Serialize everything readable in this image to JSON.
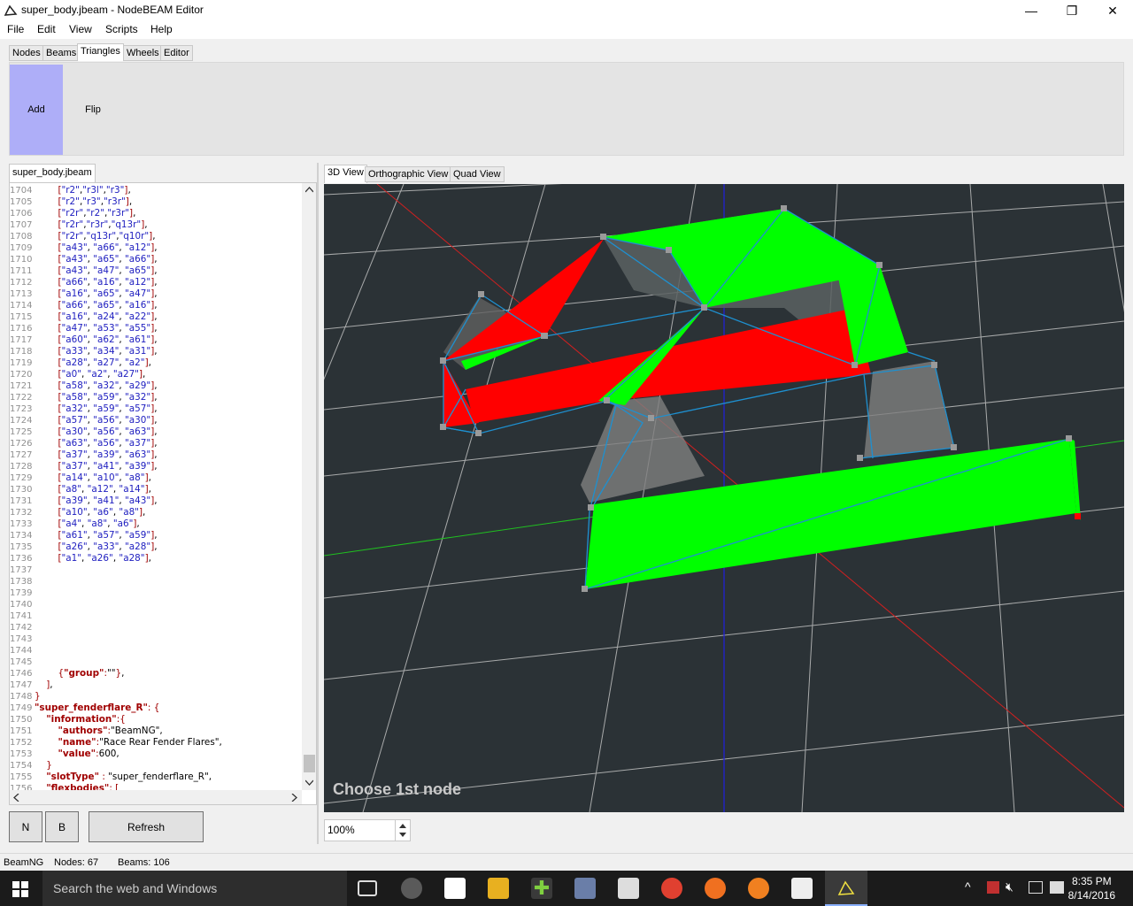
{
  "window": {
    "title": "super_body.jbeam - NodeBEAM Editor"
  },
  "menu": [
    "File",
    "Edit",
    "View",
    "Scripts",
    "Help"
  ],
  "top_tabs": [
    "Nodes",
    "Beams",
    "Triangles",
    "Wheels",
    "Editor"
  ],
  "active_top_tab": "Triangles",
  "ribbon": {
    "add_label": "Add",
    "flip_label": "Flip"
  },
  "editor": {
    "file_tab": "super_body.jbeam",
    "lines": [
      {
        "n": "1704",
        "code": "        [\"r2\",\"r3l\",\"r3\"],"
      },
      {
        "n": "1705",
        "code": "        [\"r2\",\"r3\",\"r3r\"],"
      },
      {
        "n": "1706",
        "code": "        [\"r2r\",\"r2\",\"r3r\"],"
      },
      {
        "n": "1707",
        "code": "        [\"r2r\",\"r3r\",\"q13r\"],"
      },
      {
        "n": "1708",
        "code": "        [\"r2r\",\"q13r\",\"q10r\"],"
      },
      {
        "n": "1709",
        "code": "        [\"a43\", \"a66\", \"a12\"],"
      },
      {
        "n": "1710",
        "code": "        [\"a43\", \"a65\", \"a66\"],"
      },
      {
        "n": "1711",
        "code": "        [\"a43\", \"a47\", \"a65\"],"
      },
      {
        "n": "1712",
        "code": "        [\"a66\", \"a16\", \"a12\"],"
      },
      {
        "n": "1713",
        "code": "        [\"a16\", \"a65\", \"a47\"],"
      },
      {
        "n": "1714",
        "code": "        [\"a66\", \"a65\", \"a16\"],"
      },
      {
        "n": "1715",
        "code": "        [\"a16\", \"a24\", \"a22\"],"
      },
      {
        "n": "1716",
        "code": "        [\"a47\", \"a53\", \"a55\"],"
      },
      {
        "n": "1717",
        "code": "        [\"a60\", \"a62\", \"a61\"],"
      },
      {
        "n": "1718",
        "code": "        [\"a33\", \"a34\", \"a31\"],"
      },
      {
        "n": "1719",
        "code": "        [\"a28\", \"a27\", \"a2\"],"
      },
      {
        "n": "1720",
        "code": "        [\"a0\", \"a2\", \"a27\"],"
      },
      {
        "n": "1721",
        "code": "        [\"a58\", \"a32\", \"a29\"],"
      },
      {
        "n": "1722",
        "code": "        [\"a58\", \"a59\", \"a32\"],"
      },
      {
        "n": "1723",
        "code": "        [\"a32\", \"a59\", \"a57\"],"
      },
      {
        "n": "1724",
        "code": "        [\"a57\", \"a56\", \"a30\"],"
      },
      {
        "n": "1725",
        "code": "        [\"a30\", \"a56\", \"a63\"],"
      },
      {
        "n": "1726",
        "code": "        [\"a63\", \"a56\", \"a37\"],"
      },
      {
        "n": "1727",
        "code": "        [\"a37\", \"a39\", \"a63\"],"
      },
      {
        "n": "1728",
        "code": "        [\"a37\", \"a41\", \"a39\"],"
      },
      {
        "n": "1729",
        "code": "        [\"a14\", \"a10\", \"a8\"],"
      },
      {
        "n": "1730",
        "code": "        [\"a8\", \"a12\", \"a14\"],"
      },
      {
        "n": "1731",
        "code": "        [\"a39\", \"a41\", \"a43\"],"
      },
      {
        "n": "1732",
        "code": "        [\"a10\", \"a6\", \"a8\"],"
      },
      {
        "n": "1733",
        "code": "        [\"a4\", \"a8\", \"a6\"],"
      },
      {
        "n": "1734",
        "code": "        [\"a61\", \"a57\", \"a59\"],"
      },
      {
        "n": "1735",
        "code": "        [\"a26\", \"a33\", \"a28\"],"
      },
      {
        "n": "1736",
        "code": "        [\"a1\", \"a26\", \"a28\"],"
      },
      {
        "n": "1737",
        "code": ""
      },
      {
        "n": "1738",
        "code": ""
      },
      {
        "n": "1739",
        "code": ""
      },
      {
        "n": "1740",
        "code": ""
      },
      {
        "n": "1741",
        "code": ""
      },
      {
        "n": "1742",
        "code": ""
      },
      {
        "n": "1743",
        "code": ""
      },
      {
        "n": "1744",
        "code": ""
      },
      {
        "n": "1745",
        "code": ""
      },
      {
        "n": "1746",
        "code": "        {\"group\":\"\"},"
      },
      {
        "n": "1747",
        "code": "    ],"
      },
      {
        "n": "1748",
        "code": "}"
      },
      {
        "n": "1749",
        "code": "\"super_fenderflare_R\": {"
      },
      {
        "n": "1750",
        "code": "    \"information\":{"
      },
      {
        "n": "1751",
        "code": "        \"authors\":\"BeamNG\","
      },
      {
        "n": "1752",
        "code": "        \"name\":\"Race Rear Fender Flares\","
      },
      {
        "n": "1753",
        "code": "        \"value\":600,"
      },
      {
        "n": "1754",
        "code": "    }"
      },
      {
        "n": "1755",
        "code": "    \"slotType\" : \"super_fenderflare_R\","
      },
      {
        "n": "1756",
        "code": "    \"flexbodies\": ["
      }
    ]
  },
  "buttons": {
    "n": "N",
    "b": "B",
    "refresh": "Refresh"
  },
  "view_tabs": [
    "3D View",
    "Orthographic View",
    "Quad View"
  ],
  "active_view_tab": "3D View",
  "viewport": {
    "status_text": "Choose 1st node",
    "zoom": "100%"
  },
  "statusbar": {
    "project": "BeamNG",
    "nodes": "Nodes: 67",
    "beams": "Beams: 106"
  },
  "taskbar": {
    "search_placeholder": "Search the web and Windows",
    "time": "8:35 PM",
    "date": "8/14/2016"
  },
  "colors": {
    "selected_tri": "#00ff00",
    "unselected_tri": "#ff0000",
    "beam": "#1e90d0",
    "grid": "#d0d0d0",
    "viewport_bg": "#2b3236"
  }
}
